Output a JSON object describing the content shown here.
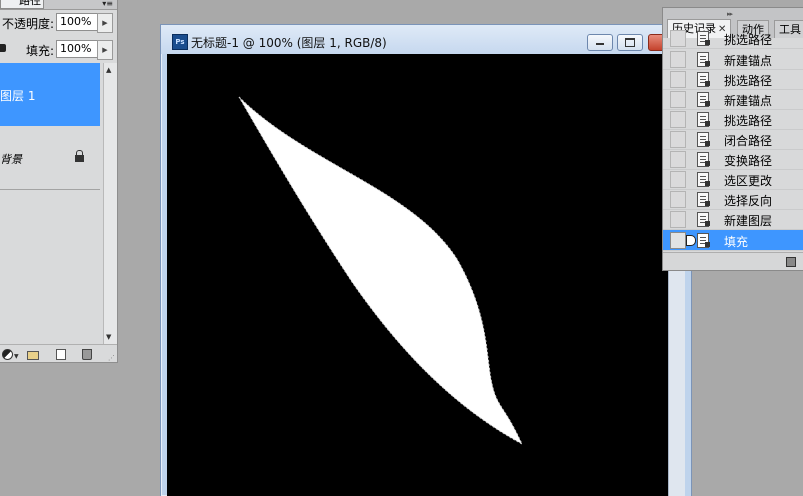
{
  "layers_panel": {
    "tab_label": "路径",
    "opacity_label": "不透明度:",
    "opacity_value": "100%",
    "fill_label": "填充:",
    "fill_value": "100%",
    "layers": [
      {
        "name": "图层 1",
        "selected": true
      },
      {
        "name": "背景",
        "locked": true
      }
    ],
    "icons": [
      "adjustment-layer-icon",
      "new-group-icon",
      "new-layer-icon",
      "trash-icon"
    ]
  },
  "document": {
    "title": "无标题-1 @ 100% (图层 1, RGB/8)",
    "app_badge": "Ps",
    "canvas_background": "#000000",
    "shape_fill": "#ffffff"
  },
  "history_panel": {
    "tabs": [
      "历史记录",
      "动作",
      "工具"
    ],
    "active_tab": 0,
    "items": [
      {
        "label": "挑选路径"
      },
      {
        "label": "新建锚点"
      },
      {
        "label": "挑选路径"
      },
      {
        "label": "新建锚点"
      },
      {
        "label": "挑选路径"
      },
      {
        "label": "闭合路径"
      },
      {
        "label": "变换路径"
      },
      {
        "label": "选区更改"
      },
      {
        "label": "选择反向"
      },
      {
        "label": "新建图层"
      },
      {
        "label": "填充",
        "selected": true
      }
    ]
  },
  "colors": {
    "accent": "#3e96ff",
    "panel_bg": "#d8d9da",
    "workspace_bg": "#a9a9a9"
  }
}
